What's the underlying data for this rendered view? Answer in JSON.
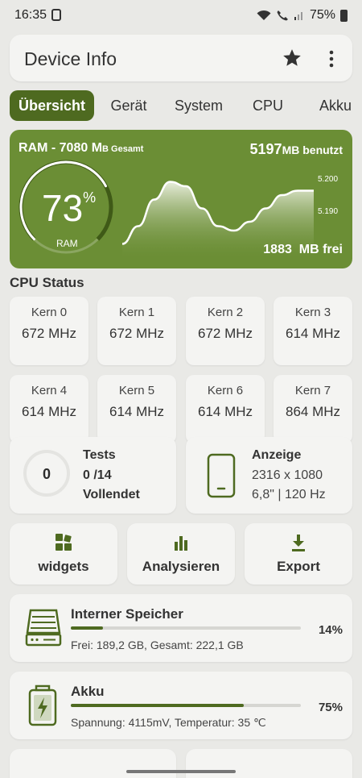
{
  "status_bar": {
    "time": "16:35",
    "battery": "75%"
  },
  "app_bar": {
    "title": "Device Info",
    "favorite_icon": "star-icon",
    "menu_icon": "more-vert-icon"
  },
  "tabs": [
    "Übersicht",
    "Gerät",
    "System",
    "CPU",
    "Akku"
  ],
  "ram": {
    "title": "RAM - 7080 M",
    "title_suffix": "B Gesamt",
    "used_value": "5197",
    "used_unit": "MB benutzt",
    "percent": "73",
    "percent_sign": "%",
    "gauge_label": "RAM",
    "free_value": "1883",
    "free_unit": "MB frei",
    "percent_fraction": 0.73,
    "axis_ticks": [
      "5.200",
      "5.190"
    ]
  },
  "chart_data": {
    "type": "area",
    "ylim": [
      5.185,
      5.205
    ],
    "yticks": [
      "5.200",
      "5.190"
    ],
    "values": [
      5.188,
      5.192,
      5.198,
      5.202,
      5.201,
      5.196,
      5.192,
      5.191,
      5.193,
      5.196,
      5.199,
      5.2,
      5.2
    ]
  },
  "cpu": {
    "heading": "CPU Status",
    "cores": [
      {
        "name": "Kern  0",
        "freq": "672 MHz"
      },
      {
        "name": "Kern  1",
        "freq": "672 MHz"
      },
      {
        "name": "Kern  2",
        "freq": "672 MHz"
      },
      {
        "name": "Kern  3",
        "freq": "614 MHz"
      },
      {
        "name": "Kern  4",
        "freq": "614 MHz"
      },
      {
        "name": "Kern  5",
        "freq": "614 MHz"
      },
      {
        "name": "Kern  6",
        "freq": "614 MHz"
      },
      {
        "name": "Kern  7",
        "freq": "864 MHz"
      }
    ]
  },
  "tests": {
    "count": "0",
    "title": "Tests",
    "progress": "0 /14",
    "status": "Vollendet"
  },
  "display": {
    "title": "Anzeige",
    "resolution": "2316 x 1080",
    "spec": "6,8\" | 120 Hz"
  },
  "actions": {
    "widgets": "widgets",
    "analyze": "Analysieren",
    "export": "Export"
  },
  "storage": {
    "title": "Interner Speicher",
    "percent": "14%",
    "fill": 0.14,
    "detail": "Frei: 189,2 GB,  Gesamt: 222,1 GB"
  },
  "battery": {
    "title": "Akku",
    "percent": "75%",
    "fill": 0.75,
    "detail": "Spannung: 4115mV,  Temperatur: 35 ℃"
  },
  "colors": {
    "accent": "#4e6a20",
    "ram_card": "#6b8e35",
    "background": "#e9e9e6",
    "card": "#f4f4f2"
  }
}
